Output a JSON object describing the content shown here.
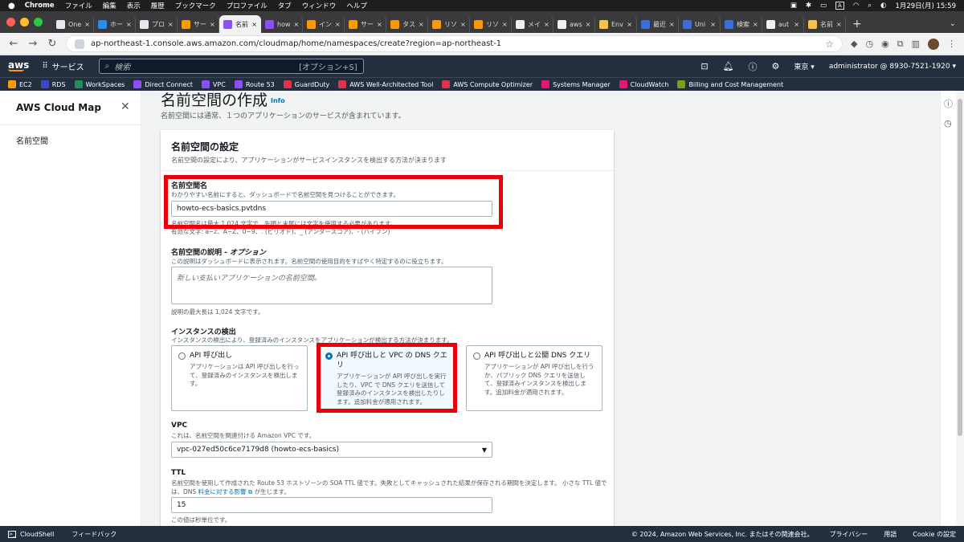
{
  "macbar": {
    "apple": "",
    "items": [
      "Chrome",
      "ファイル",
      "編集",
      "表示",
      "履歴",
      "ブックマーク",
      "プロファイル",
      "タブ",
      "ウィンドウ",
      "ヘルプ"
    ],
    "input_badge": "A",
    "date_time": "1月29日(月) 15:59"
  },
  "browser": {
    "tabs": [
      {
        "label": "One",
        "color": "#e8eaed"
      },
      {
        "label": "ホー",
        "color": "#2a8bf2"
      },
      {
        "label": "プロ",
        "color": "#e8eaed"
      },
      {
        "label": "サー",
        "color": "#ff9900"
      },
      {
        "label": "名前",
        "color": "#8c4fff",
        "active": true
      },
      {
        "label": "how",
        "color": "#8c4fff"
      },
      {
        "label": "イン",
        "color": "#ff9900"
      },
      {
        "label": "サー",
        "color": "#ff9900"
      },
      {
        "label": "タス",
        "color": "#ff9900"
      },
      {
        "label": "リソ",
        "color": "#ff9900"
      },
      {
        "label": "リソ",
        "color": "#ff9900"
      },
      {
        "label": "メイ",
        "color": "#f0f0f0"
      },
      {
        "label": "aws",
        "color": "#f0f0f0"
      },
      {
        "label": "Env",
        "color": "#f6c344"
      },
      {
        "label": "最近",
        "color": "#3c6ed8"
      },
      {
        "label": "Uni",
        "color": "#3c6ed8"
      },
      {
        "label": "検索",
        "color": "#3c6ed8"
      },
      {
        "label": "aut",
        "color": "#f0f0f0"
      },
      {
        "label": "名前",
        "color": "#f6c344"
      }
    ],
    "url": "ap-northeast-1.console.aws.amazon.com/cloudmap/home/namespaces/create?region=ap-northeast-1"
  },
  "aws_nav": {
    "logo": "aws",
    "services_label": "サービス",
    "search_placeholder": "検索",
    "search_shortcut": "[オプション+S]",
    "region": "東京 ▾",
    "account": "administrator @ 8930-7521-1920 ▾"
  },
  "favorites": [
    {
      "label": "EC2",
      "color": "#ff9900"
    },
    {
      "label": "RDS",
      "color": "#3b48cc"
    },
    {
      "label": "WorkSpaces",
      "color": "#1f8f60"
    },
    {
      "label": "Direct Connect",
      "color": "#8c4fff"
    },
    {
      "label": "VPC",
      "color": "#8c4fff"
    },
    {
      "label": "Route 53",
      "color": "#8c4fff"
    },
    {
      "label": "GuardDuty",
      "color": "#dd344c"
    },
    {
      "label": "AWS Well-Architected Tool",
      "color": "#dd344c"
    },
    {
      "label": "AWS Compute Optimizer",
      "color": "#dd344c"
    },
    {
      "label": "Systems Manager",
      "color": "#e7157b"
    },
    {
      "label": "CloudWatch",
      "color": "#e7157b"
    },
    {
      "label": "Billing and Cost Management",
      "color": "#7aa116"
    }
  ],
  "sidenav": {
    "title": "AWS Cloud Map",
    "items": [
      "名前空間"
    ]
  },
  "page": {
    "title": "名前空間の作成",
    "info_link": "Info",
    "description": "名前空間には通常、１つのアプリケーションのサービスが含まれています。"
  },
  "panel": {
    "title": "名前空間の設定",
    "description": "名前空間の設定により、アプリケーションがサービスインスタンスを検出する方法が決まります",
    "name_field": {
      "label": "名前空間名",
      "sub": "わかりやすい名前にすると、ダッシュボードで名前空間を見つけることができます。",
      "value": "howto-ecs-basics.pvtdns",
      "constraint1": "名前空間名は最大 1,024 文字で、先頭と末尾には文字を使用する必要があります。",
      "constraint2": "有効な文字: a~z、A~Z、0~9、. (ピリオド)、_ (アンダースコア)、- (ハイフン)"
    },
    "desc_field": {
      "label": "名前空間の説明 - ",
      "label_optional": "オプション",
      "sub": "この説明はダッシュボードに表示されます。名前空間の使用目的をすばやく特定するのに役立ちます。",
      "placeholder": "新しい支払いアプリケーションの名前空間。",
      "constraint": "説明の最大長は 1,024 文字です。"
    },
    "discovery": {
      "label": "インスタンスの検出",
      "sub": "インスタンスの検出により、登録済みのインスタンスをアプリケーションが検出する方法が決まります。",
      "options": [
        {
          "label": "API 呼び出し",
          "desc": "アプリケーションは API 呼び出しを行って、登録済みのインスタンスを検出します。",
          "selected": false
        },
        {
          "label": "API 呼び出しと VPC の DNS クエリ",
          "desc": "アプリケーションが API 呼び出しを実行したり、VPC で DNS クエリを送信して登録済みのインスタンスを検出したりします。追加料金が適用されます。",
          "selected": true
        },
        {
          "label": "API 呼び出しと公開 DNS クエリ",
          "desc": "アプリケーションが API 呼び出しを行うか、パブリック DNS クエリを送信して、登録済みインスタンスを検出します。追加料金が適用されます。",
          "selected": false
        }
      ]
    },
    "vpc": {
      "label": "VPC",
      "sub": "これは、名前空間を関連付ける Amazon VPC です。",
      "value": "vpc-027ed50c6ce7179d8 (howto-ecs-basics)"
    },
    "ttl": {
      "label": "TTL",
      "sub1": "名前空間を使用して作成された Route 53 ホストゾーンの SOA TTL 値です。失敗としてキャッシュされた結果が保存される期間を決定します。 小さな TTL 値では、DNS",
      "sub_link": "料金に対する影響",
      "sub2": "が生じます。",
      "value": "15",
      "constraint": "この値は秒単位です。"
    }
  },
  "footer": {
    "cloudshell": "CloudShell",
    "feedback": "フィードバック",
    "copyright": "© 2024, Amazon Web Services, Inc. またはその関連会社。",
    "privacy": "プライバシー",
    "terms": "用語",
    "cookie": "Cookie の設定"
  },
  "colors": {
    "aws_nav": "#232f3e",
    "aws_orange": "#ff9900",
    "link_blue": "#0073bb",
    "highlight_red": "#e8000b"
  }
}
